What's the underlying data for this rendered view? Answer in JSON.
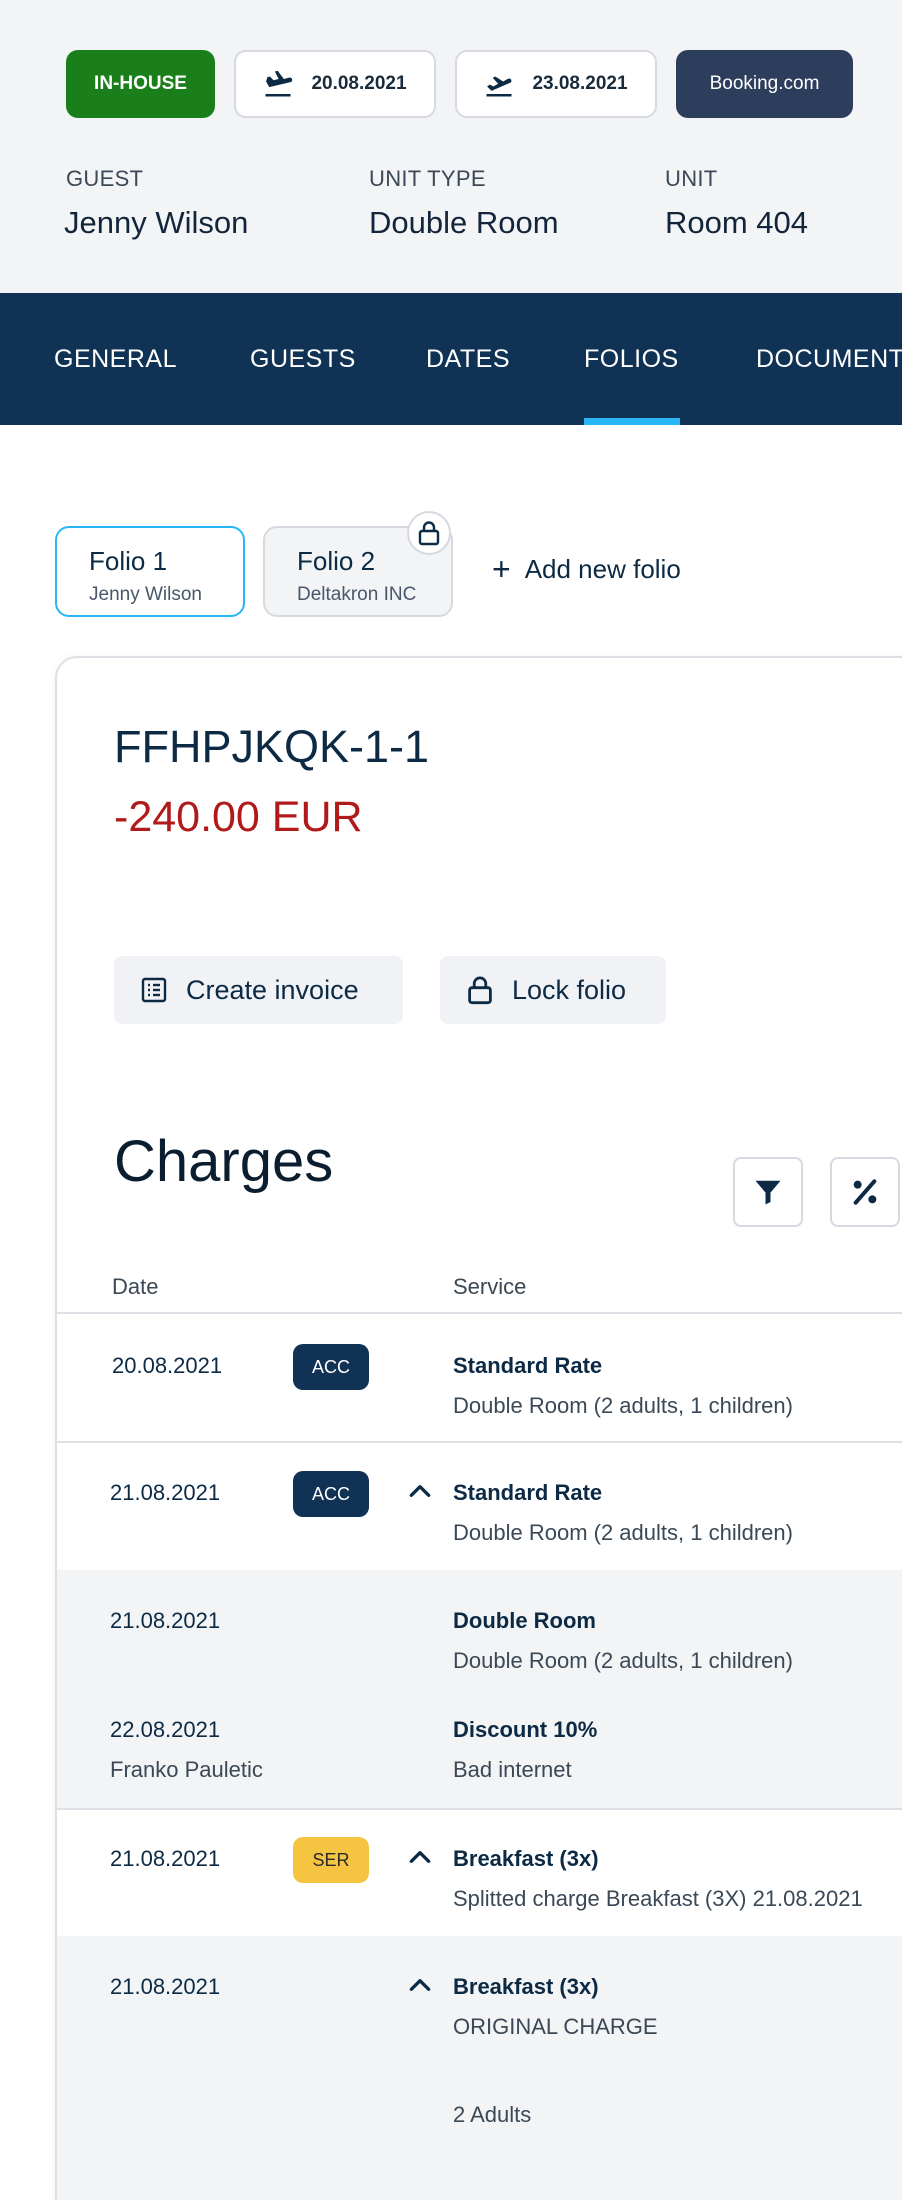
{
  "header": {
    "status": "IN-HOUSE",
    "arrival_date": "20.08.2021",
    "departure_date": "23.08.2021",
    "source": "Booking.com",
    "guest_label": "GUEST",
    "guest_value": "Jenny Wilson",
    "unit_type_label": "UNIT TYPE",
    "unit_type_value": "Double Room",
    "unit_label": "UNIT",
    "unit_value": "Room 404",
    "colors": {
      "status": "#1a7f1a",
      "source": "#2c3e5c"
    }
  },
  "nav": {
    "tabs": [
      "GENERAL",
      "GUESTS",
      "DATES",
      "FOLIOS",
      "DOCUMENT"
    ],
    "active": "FOLIOS",
    "colors": {
      "background": "#103355",
      "indicator": "#29b6f6"
    }
  },
  "folios": {
    "items": [
      {
        "title": "Folio 1",
        "subtitle": "Jenny Wilson",
        "locked": false,
        "selected": true
      },
      {
        "title": "Folio 2",
        "subtitle": "Deltakron INC",
        "locked": true,
        "selected": false
      }
    ],
    "add_label": "Add new folio"
  },
  "folio_detail": {
    "number": "FFHPJKQK-1-1",
    "balance": "-240.00 EUR",
    "create_invoice_label": "Create invoice",
    "lock_folio_label": "Lock folio",
    "colors": {
      "balance": "#b01a1a"
    }
  },
  "charges": {
    "title": "Charges",
    "columns": {
      "date": "Date",
      "service": "Service"
    },
    "rows": [
      {
        "date": "20.08.2021",
        "badge": "ACC",
        "service": "Standard Rate",
        "description": "Double Room (2 adults, 1 children)"
      },
      {
        "date": "21.08.2021",
        "badge": "ACC",
        "service": "Standard Rate",
        "description": "Double Room (2 adults, 1 children)"
      },
      {
        "date": "21.08.2021",
        "service": "Double Room",
        "description": "Double Room (2 adults, 1 children)"
      },
      {
        "date": "22.08.2021",
        "user": "Franko Pauletic",
        "service": "Discount 10%",
        "description": "Bad internet"
      },
      {
        "date": "21.08.2021",
        "badge": "SER",
        "service": "Breakfast  (3x)",
        "description": "Splitted charge Breakfast  (3X) 21.08.2021"
      },
      {
        "date": "21.08.2021",
        "service": "Breakfast  (3x)",
        "description": "ORIGINAL CHARGE",
        "extra": "2 Adults"
      }
    ],
    "icons": [
      "filter-icon",
      "percent-icon",
      "chevron-up-icon"
    ]
  }
}
